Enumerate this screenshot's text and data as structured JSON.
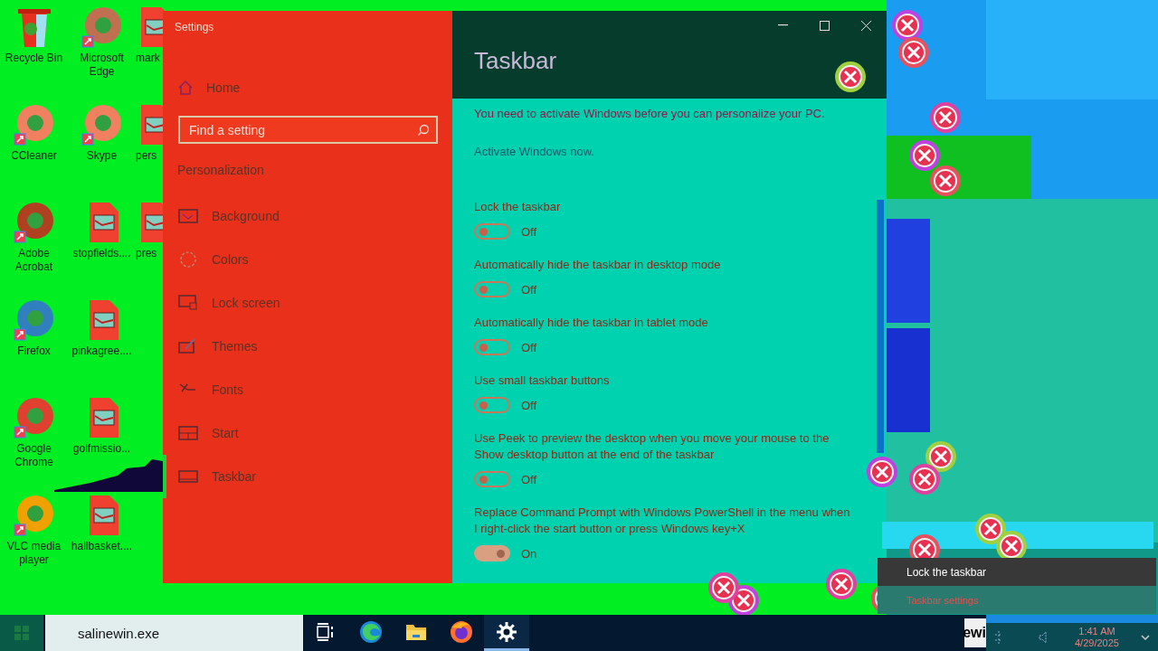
{
  "desktop_icons": [
    {
      "label": "Recycle Bin",
      "kind": "bin"
    },
    {
      "label": "CCleaner",
      "kind": "app"
    },
    {
      "label": "Adobe Acrobat",
      "kind": "app"
    },
    {
      "label": "Firefox",
      "kind": "app"
    },
    {
      "label": "Google Chrome",
      "kind": "app"
    },
    {
      "label": "VLC media player",
      "kind": "app"
    },
    {
      "label": "Microsoft Edge",
      "kind": "app"
    },
    {
      "label": "Skype",
      "kind": "app"
    },
    {
      "label": "stopfields....",
      "kind": "file"
    },
    {
      "label": "pinkagree....",
      "kind": "file"
    },
    {
      "label": "golfmissio...",
      "kind": "file"
    },
    {
      "label": "hallbasket....",
      "kind": "file"
    },
    {
      "label": "mark",
      "kind": "file"
    },
    {
      "label": "pers",
      "kind": "file"
    },
    {
      "label": "pres",
      "kind": "file"
    }
  ],
  "settings_window": {
    "title": "Settings",
    "home": "Home",
    "search": {
      "placeholder": "Find a setting"
    },
    "section": "Personalization",
    "nav_items": [
      {
        "label": "Background",
        "selected": false
      },
      {
        "label": "Colors",
        "selected": false
      },
      {
        "label": "Lock screen",
        "selected": false
      },
      {
        "label": "Themes",
        "selected": false
      },
      {
        "label": "Fonts",
        "selected": false
      },
      {
        "label": "Start",
        "selected": false
      },
      {
        "label": "Taskbar",
        "selected": true
      }
    ],
    "page_title": "Taskbar",
    "notice": "You need to activate Windows before you can personalize your PC.",
    "activate_link": "Activate Windows now.",
    "toggles": [
      {
        "label": "Lock the taskbar",
        "on": false,
        "state": "Off"
      },
      {
        "label": "Automatically hide the taskbar in desktop mode",
        "on": false,
        "state": "Off"
      },
      {
        "label": "Automatically hide the taskbar in tablet mode",
        "on": false,
        "state": "Off"
      },
      {
        "label": "Use small taskbar buttons",
        "on": false,
        "state": "Off"
      },
      {
        "label": "Use Peek to preview the desktop when you move your mouse to the Show desktop button at the end of the taskbar",
        "on": false,
        "state": "Off"
      },
      {
        "label": "Replace Command Prompt with Windows PowerShell in the menu when I right-click the start button or press Windows key+X",
        "on": true,
        "state": "On"
      }
    ]
  },
  "context_menu": {
    "items": [
      "Lock the taskbar",
      "Taskbar settings"
    ]
  },
  "taskbar": {
    "search": {
      "value": "salinewin.exe"
    },
    "pinned": [
      {
        "kind": "taskview"
      },
      {
        "kind": "edge"
      },
      {
        "kind": "folder"
      },
      {
        "kind": "firefox"
      },
      {
        "kind": "settings",
        "selected": true
      }
    ],
    "clipped_text": "ewi",
    "time": "1:41 AM",
    "date": "4/29/2025"
  }
}
